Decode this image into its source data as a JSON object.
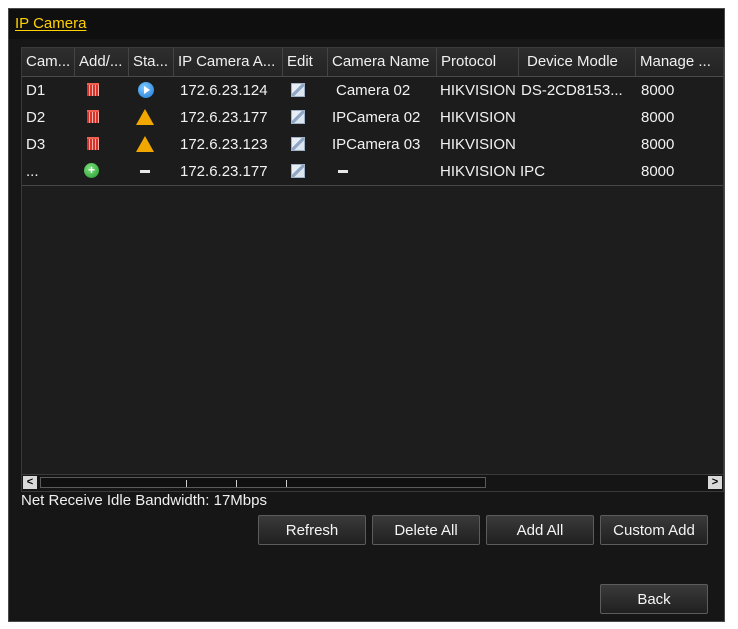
{
  "window": {
    "title": "IP Camera"
  },
  "table": {
    "headers": [
      "Cam...",
      "Add/...",
      "Sta...",
      "IP Camera A...",
      "Edit",
      "Camera Name",
      "Protocol",
      "Device Modle",
      "Manage ..."
    ],
    "rows": [
      {
        "cam": "D1",
        "add_icon": "trash-icon",
        "status_icon": "play-icon",
        "ip": "172.6.23.124",
        "edit_icon": "edit-icon",
        "name": "Camera 02",
        "protocol": "HIKVISION",
        "model": "DS-2CD8153...",
        "port": "8000"
      },
      {
        "cam": "D2",
        "add_icon": "trash-icon",
        "status_icon": "warning-icon",
        "ip": "172.6.23.177",
        "edit_icon": "edit-icon",
        "name": "IPCamera 02",
        "protocol": "HIKVISION",
        "model": "",
        "port": "8000"
      },
      {
        "cam": "D3",
        "add_icon": "trash-icon",
        "status_icon": "warning-icon",
        "ip": "172.6.23.123",
        "edit_icon": "edit-icon",
        "name": "IPCamera 03",
        "protocol": "HIKVISION",
        "model": "",
        "port": "8000"
      },
      {
        "cam": "...",
        "add_icon": "add-icon",
        "status_icon": "dash-icon",
        "ip": "172.6.23.177",
        "edit_icon": "edit-icon",
        "name": "",
        "protocol": "HIKVISION IPC",
        "model": "",
        "port": "8000"
      }
    ]
  },
  "scrollbar": {
    "left_arrow": "<",
    "right_arrow": ">"
  },
  "status": {
    "bandwidth": "Net Receive Idle Bandwidth: 17Mbps"
  },
  "buttons": {
    "refresh": "Refresh",
    "delete_all": "Delete All",
    "add_all": "Add All",
    "custom_add": "Custom Add",
    "back": "Back"
  },
  "colors": {
    "title": "#ffd200",
    "background": "#161616"
  }
}
